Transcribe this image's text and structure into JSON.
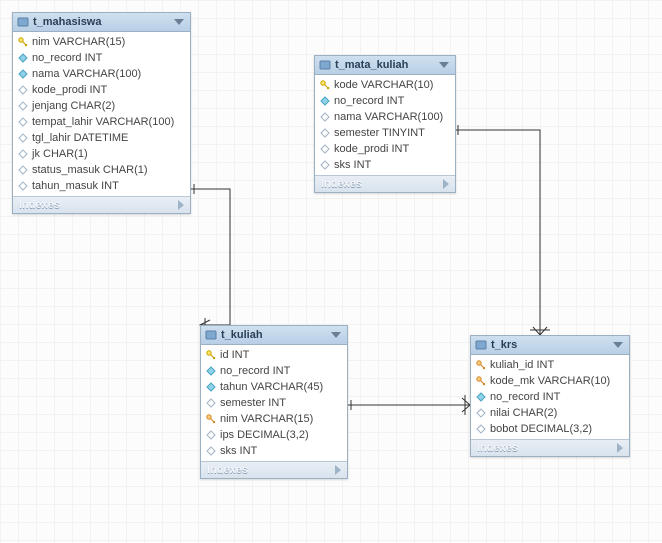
{
  "ui": {
    "indexes_label": "Indexes"
  },
  "icon_class": {
    "pk": "i-pk",
    "fk": "i-fk",
    "req": "i-req",
    "opt": "i-opt"
  },
  "tables": [
    {
      "name": "t_mahasiswa",
      "columns": [
        {
          "icon": "pk",
          "label": "nim VARCHAR(15)"
        },
        {
          "icon": "req",
          "label": "no_record INT"
        },
        {
          "icon": "req",
          "label": "nama VARCHAR(100)"
        },
        {
          "icon": "opt",
          "label": "kode_prodi INT"
        },
        {
          "icon": "opt",
          "label": "jenjang CHAR(2)"
        },
        {
          "icon": "opt",
          "label": "tempat_lahir VARCHAR(100)"
        },
        {
          "icon": "opt",
          "label": "tgl_lahir DATETIME"
        },
        {
          "icon": "opt",
          "label": "jk CHAR(1)"
        },
        {
          "icon": "opt",
          "label": "status_masuk CHAR(1)"
        },
        {
          "icon": "opt",
          "label": "tahun_masuk INT"
        }
      ]
    },
    {
      "name": "t_mata_kuliah",
      "columns": [
        {
          "icon": "pk",
          "label": "kode VARCHAR(10)"
        },
        {
          "icon": "req",
          "label": "no_record INT"
        },
        {
          "icon": "opt",
          "label": "nama VARCHAR(100)"
        },
        {
          "icon": "opt",
          "label": "semester TINYINT"
        },
        {
          "icon": "opt",
          "label": "kode_prodi INT"
        },
        {
          "icon": "opt",
          "label": "sks INT"
        }
      ]
    },
    {
      "name": "t_kuliah",
      "columns": [
        {
          "icon": "pk",
          "label": "id INT"
        },
        {
          "icon": "req",
          "label": "no_record INT"
        },
        {
          "icon": "req",
          "label": "tahun VARCHAR(45)"
        },
        {
          "icon": "opt",
          "label": "semester INT"
        },
        {
          "icon": "fk",
          "label": "nim VARCHAR(15)"
        },
        {
          "icon": "opt",
          "label": "ips DECIMAL(3,2)"
        },
        {
          "icon": "opt",
          "label": "sks INT"
        }
      ]
    },
    {
      "name": "t_krs",
      "columns": [
        {
          "icon": "fk",
          "label": "kuliah_id INT"
        },
        {
          "icon": "fk",
          "label": "kode_mk VARCHAR(10)"
        },
        {
          "icon": "req",
          "label": "no_record INT"
        },
        {
          "icon": "opt",
          "label": "nilai CHAR(2)"
        },
        {
          "icon": "opt",
          "label": "bobot DECIMAL(3,2)"
        }
      ]
    }
  ],
  "relationships": [
    {
      "from": "t_mahasiswa",
      "to": "t_kuliah",
      "type": "one-to-many"
    },
    {
      "from": "t_mata_kuliah",
      "to": "t_krs",
      "type": "one-to-many"
    },
    {
      "from": "t_kuliah",
      "to": "t_krs",
      "type": "one-to-many"
    }
  ]
}
